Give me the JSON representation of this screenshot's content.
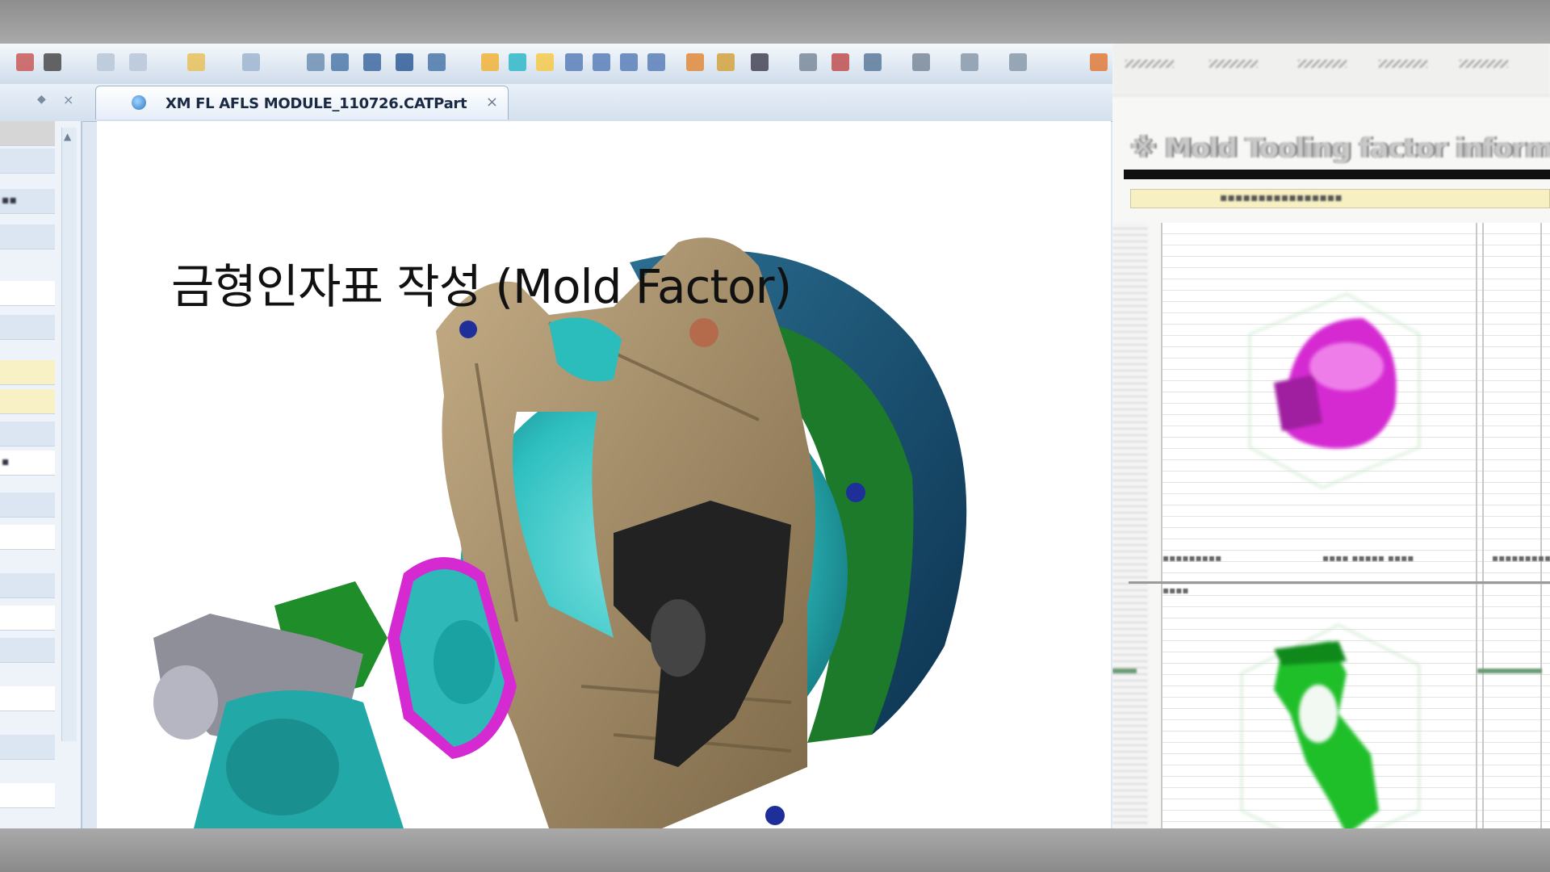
{
  "document_tab": {
    "label": "XM FL AFLS MODULE_110726.CATPart"
  },
  "caption": {
    "title": "금형인자표 작성 (Mold Factor)"
  },
  "info_window": {
    "title": "※ Mold Tooling factor information"
  },
  "icons": {
    "pin": "pin-icon",
    "close": "close-icon",
    "part_document": "part-document-icon"
  },
  "colors": {
    "housing_tan": "#a08a66",
    "reflector_magenta": "#d52ad2",
    "reflector_cyan": "#2fc0c0",
    "bezel_navy": "#134a6a",
    "bracket_green": "#1f8d2a",
    "bracket_black": "#222222",
    "bracket_grey": "#8f8f99"
  }
}
